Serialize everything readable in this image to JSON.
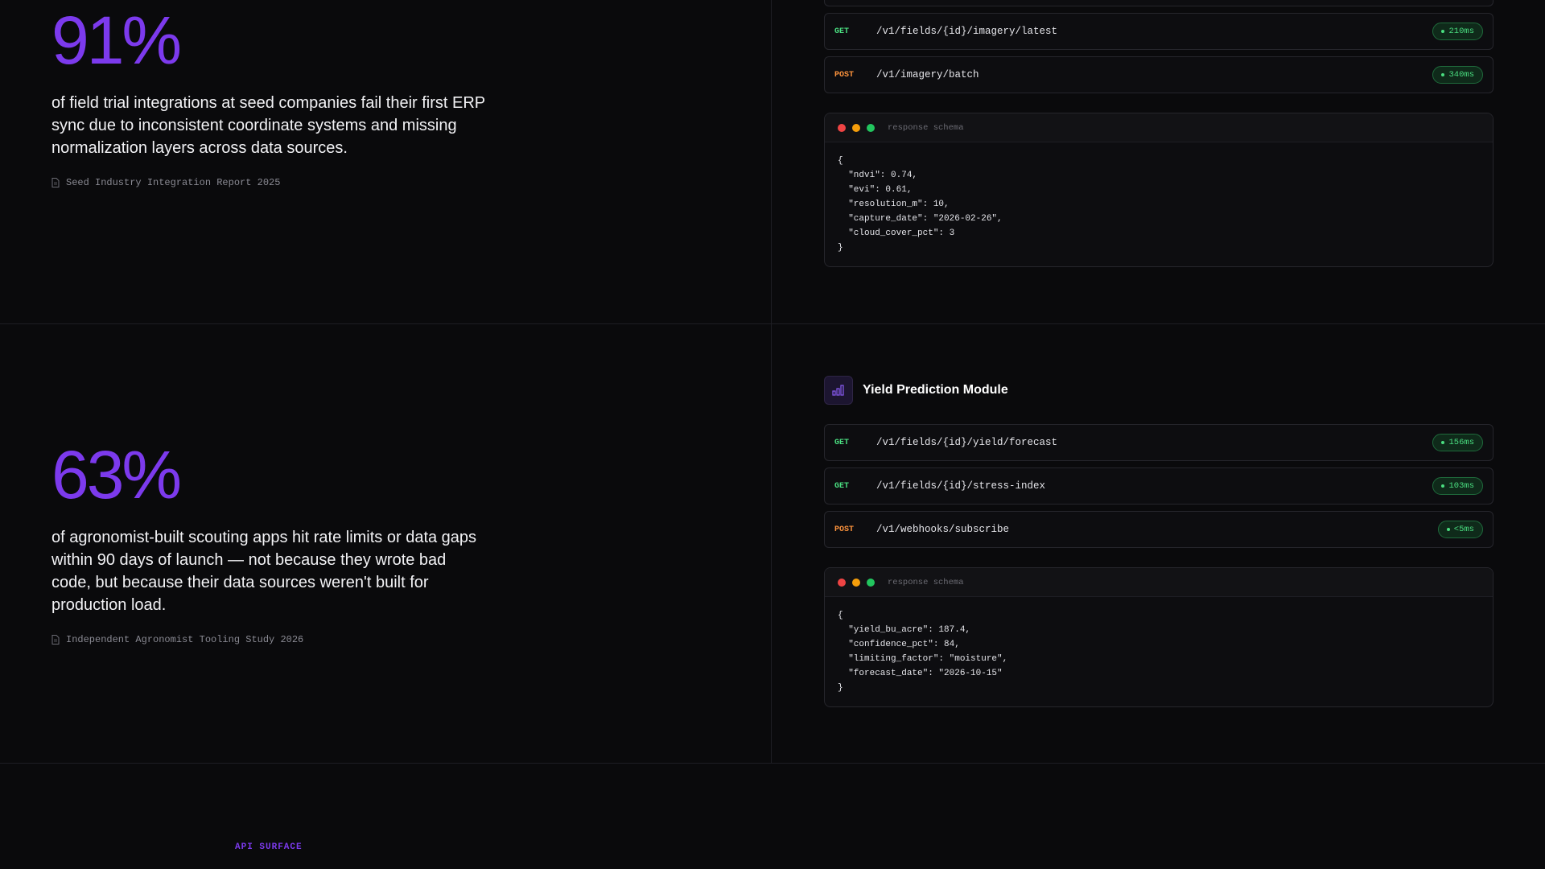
{
  "stats": [
    {
      "value": "91%",
      "text": "of field trial integrations at seed companies fail their first ERP sync due to inconsistent coordinate systems and missing normalization layers across data sources.",
      "source": "Seed Industry Integration Report 2025"
    },
    {
      "value": "63%",
      "text": "of agronomist-built scouting apps hit rate limits or data gaps within 90 days of launch — not because they wrote bad code, but because their data sources weren't built for production load.",
      "source": "Independent Agronomist Tooling Study 2026"
    }
  ],
  "imagery": {
    "endpoints": [
      {
        "method": "GET",
        "path": "/v1/fields/{id}/imagery/latest",
        "latency": "210ms"
      },
      {
        "method": "POST",
        "path": "/v1/imagery/batch",
        "latency": "340ms"
      }
    ],
    "schema_title": "response schema",
    "schema_body": "{\n  \"ndvi\": 0.74,\n  \"evi\": 0.61,\n  \"resolution_m\": 10,\n  \"capture_date\": \"2026-02-26\",\n  \"cloud_cover_pct\": 3\n}"
  },
  "yield_module": {
    "title": "Yield Prediction Module",
    "icon": "bar-chart-icon",
    "endpoints": [
      {
        "method": "GET",
        "path": "/v1/fields/{id}/yield/forecast",
        "latency": "156ms"
      },
      {
        "method": "GET",
        "path": "/v1/fields/{id}/stress-index",
        "latency": "103ms"
      },
      {
        "method": "POST",
        "path": "/v1/webhooks/subscribe",
        "latency": "<5ms"
      }
    ],
    "schema_title": "response schema",
    "schema_body": "{\n  \"yield_bu_acre\": 187.4,\n  \"confidence_pct\": 84,\n  \"limiting_factor\": \"moisture\",\n  \"forecast_date\": \"2026-10-15\"\n}"
  },
  "next_section": {
    "eyebrow": "API SURFACE"
  },
  "colors": {
    "accent": "#7c3aed",
    "get": "#4ade80",
    "post": "#fb923c",
    "traffic_red": "#ef4444",
    "traffic_yellow": "#f59e0b",
    "traffic_green": "#22c55e"
  }
}
